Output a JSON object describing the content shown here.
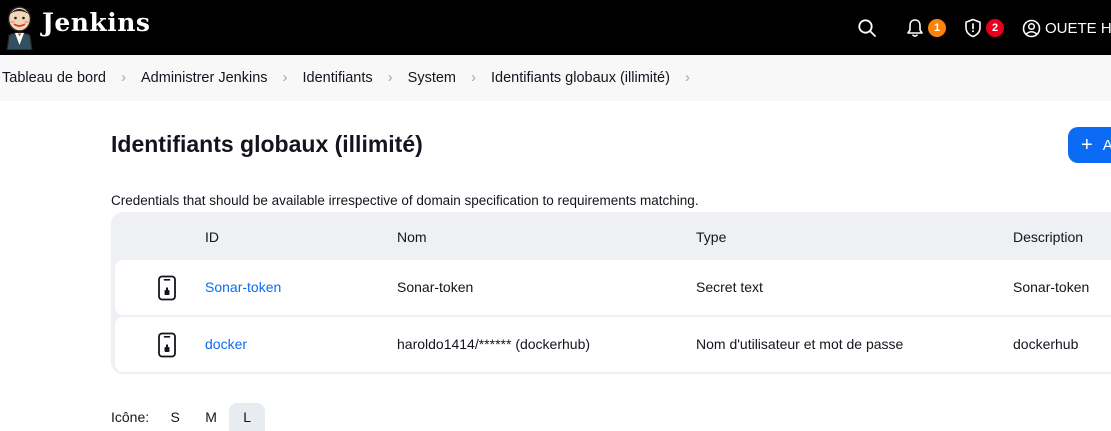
{
  "header": {
    "brand": "Jenkins",
    "notifications_count": "1",
    "security_count": "2",
    "user_name": "OUETE HA",
    "notifications_badge_color": "#fe820a",
    "security_badge_color": "#e6001f"
  },
  "breadcrumb": {
    "items": [
      "Tableau de bord",
      "Administrer Jenkins",
      "Identifiants",
      "System",
      "Identifiants globaux (illimité)"
    ]
  },
  "page": {
    "title": "Identifiants globaux (illimité)",
    "add_label": "A",
    "description": "Credentials that should be available irrespective of domain specification to requirements matching."
  },
  "table": {
    "headers": [
      "ID",
      "Nom",
      "Type",
      "Description"
    ],
    "rows": [
      {
        "icon": "mobile-token-icon",
        "id": "Sonar-token",
        "name": "Sonar-token",
        "type": "Secret text",
        "description": "Sonar-token"
      },
      {
        "icon": "mobile-token-icon",
        "id": "docker",
        "name": "haroldo1414/****** (dockerhub)",
        "type": "Nom d'utilisateur et mot de passe",
        "description": "dockerhub"
      }
    ]
  },
  "icon_size": {
    "label": "Icône:",
    "options": [
      "S",
      "M",
      "L"
    ],
    "selected": "L"
  },
  "colors": {
    "accent": "#0b6bf5",
    "header_bg": "#000000"
  }
}
